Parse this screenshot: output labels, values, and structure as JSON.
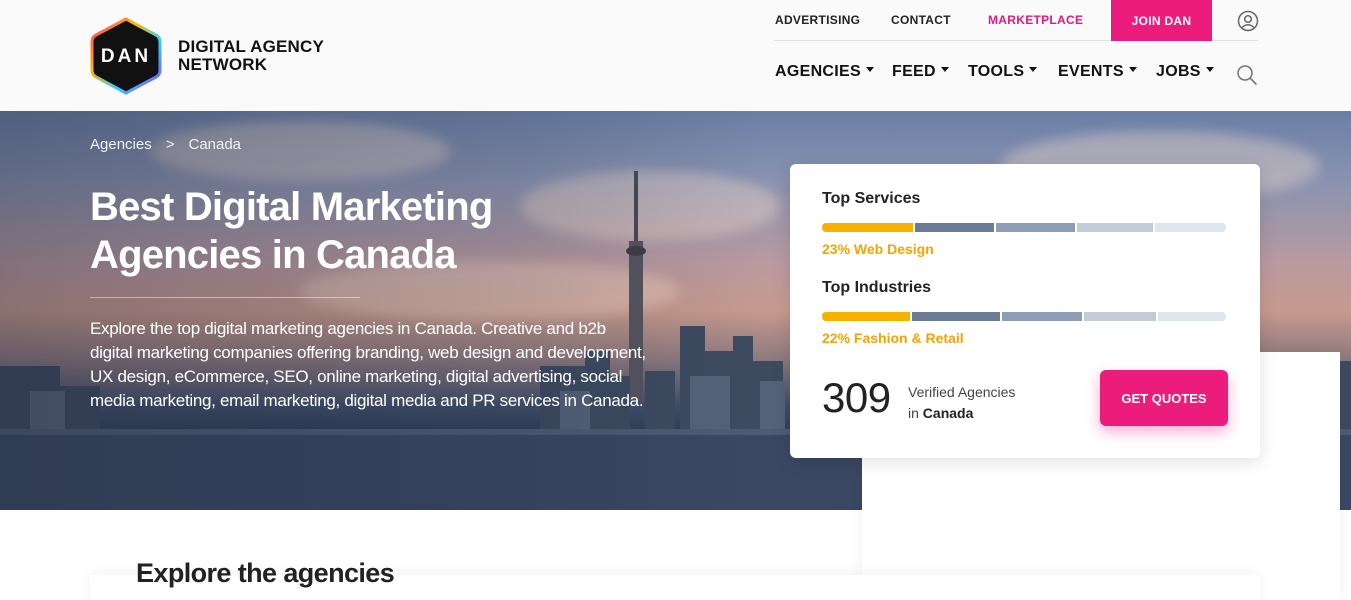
{
  "brand": {
    "badge_text": "DAN",
    "name_line1": "DIGITAL AGENCY",
    "name_line2": "NETWORK"
  },
  "top_nav": {
    "advertising": "ADVERTISING",
    "contact": "CONTACT",
    "marketplace": "MARKETPLACE",
    "join": "JOIN DAN"
  },
  "main_nav": {
    "agencies": "AGENCIES",
    "feed": "FEED",
    "tools": "TOOLS",
    "events": "EVENTS",
    "jobs": "JOBS"
  },
  "breadcrumb": {
    "first": "Agencies",
    "separator": ">",
    "current": "Canada"
  },
  "hero": {
    "title": "Best Digital Marketing Agencies in Canada",
    "description": "Explore the top digital marketing agencies in Canada. Creative and b2b digital marketing companies offering branding, web design and development, UX design, eCommerce, SEO, online marketing, digital advertising, social media marketing, email marketing, digital media and PR services in Canada."
  },
  "stats": {
    "services_heading": "Top Services",
    "services_top": "23% Web Design",
    "services_segments": [
      23,
      20,
      20,
      19,
      18
    ],
    "industries_heading": "Top Industries",
    "industries_top": "22% Fashion & Retail",
    "industries_segments": [
      22,
      22,
      20,
      18,
      17
    ],
    "segment_colors": [
      "#f7b200",
      "#6b7b94",
      "#8f9db3",
      "#c2ccd9",
      "#dfe5ec"
    ],
    "count": "309",
    "count_label": "Verified Agencies",
    "count_location_prefix": "in",
    "count_location": "Canada",
    "cta": "GET QUOTES"
  },
  "explore": {
    "title": "Explore the agencies"
  },
  "colors": {
    "accent": "#ec1c7d",
    "highlight": "#f4a300"
  }
}
